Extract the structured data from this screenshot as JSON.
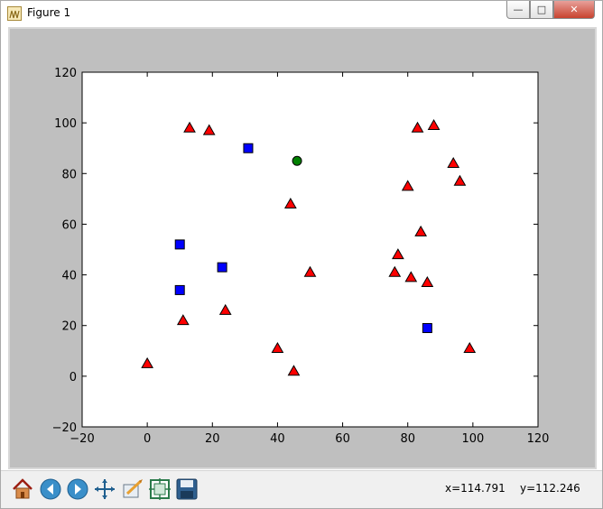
{
  "window": {
    "title": "Figure 1"
  },
  "status": {
    "x_readout": "x=114.791",
    "y_readout": "y=112.246"
  },
  "toolbar": {
    "tools": [
      "home-icon",
      "back-icon",
      "forward-icon",
      "pan-icon",
      "zoom-icon",
      "subplots-icon",
      "save-icon"
    ]
  },
  "colors": {
    "figure_bg": "#bfbfbf",
    "axes_bg": "#ffffff",
    "triangle": "#ff0000",
    "square": "#0000ff",
    "circle": "#008000"
  },
  "chart_data": {
    "type": "scatter",
    "xlim": [
      -20,
      120
    ],
    "ylim": [
      -20,
      120
    ],
    "xticks": [
      -20,
      0,
      20,
      40,
      60,
      80,
      100,
      120
    ],
    "yticks": [
      -20,
      0,
      20,
      40,
      60,
      80,
      100,
      120
    ],
    "grid": false,
    "series": [
      {
        "marker": "triangle",
        "color": "#ff0000",
        "points": [
          [
            0,
            5
          ],
          [
            11,
            22
          ],
          [
            13,
            98
          ],
          [
            19,
            97
          ],
          [
            24,
            26
          ],
          [
            40,
            11
          ],
          [
            44,
            68
          ],
          [
            45,
            2
          ],
          [
            50,
            41
          ],
          [
            76,
            41
          ],
          [
            77,
            48
          ],
          [
            80,
            75
          ],
          [
            81,
            39
          ],
          [
            83,
            98
          ],
          [
            84,
            57
          ],
          [
            86,
            37
          ],
          [
            88,
            99
          ],
          [
            94,
            84
          ],
          [
            96,
            77
          ],
          [
            99,
            11
          ]
        ]
      },
      {
        "marker": "square",
        "color": "#0000ff",
        "points": [
          [
            10,
            52
          ],
          [
            10,
            34
          ],
          [
            23,
            43
          ],
          [
            31,
            90
          ],
          [
            86,
            19
          ]
        ]
      },
      {
        "marker": "circle",
        "color": "#008000",
        "points": [
          [
            46,
            85
          ]
        ]
      }
    ]
  }
}
